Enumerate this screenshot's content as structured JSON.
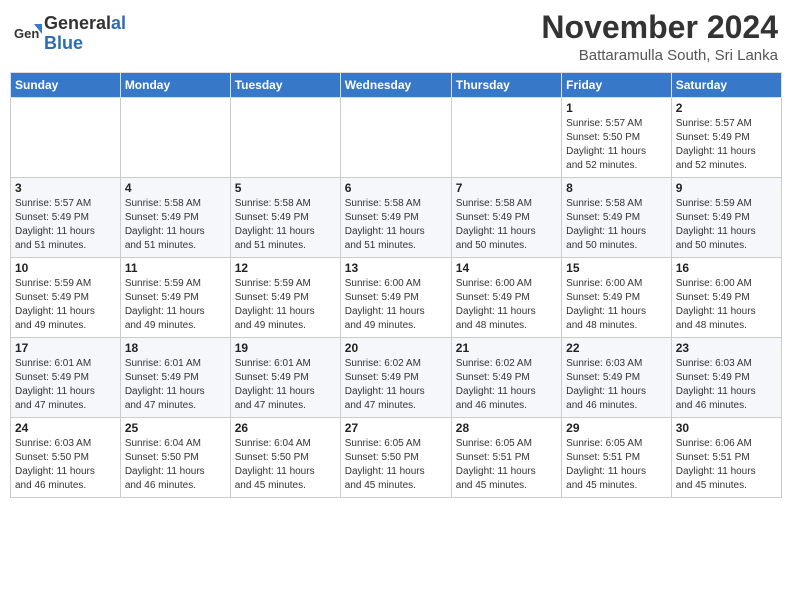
{
  "header": {
    "logo_line1": "General",
    "logo_line2": "Blue",
    "month": "November 2024",
    "location": "Battaramulla South, Sri Lanka"
  },
  "weekdays": [
    "Sunday",
    "Monday",
    "Tuesday",
    "Wednesday",
    "Thursday",
    "Friday",
    "Saturday"
  ],
  "weeks": [
    [
      {
        "day": "",
        "info": ""
      },
      {
        "day": "",
        "info": ""
      },
      {
        "day": "",
        "info": ""
      },
      {
        "day": "",
        "info": ""
      },
      {
        "day": "",
        "info": ""
      },
      {
        "day": "1",
        "info": "Sunrise: 5:57 AM\nSunset: 5:50 PM\nDaylight: 11 hours\nand 52 minutes."
      },
      {
        "day": "2",
        "info": "Sunrise: 5:57 AM\nSunset: 5:49 PM\nDaylight: 11 hours\nand 52 minutes."
      }
    ],
    [
      {
        "day": "3",
        "info": "Sunrise: 5:57 AM\nSunset: 5:49 PM\nDaylight: 11 hours\nand 51 minutes."
      },
      {
        "day": "4",
        "info": "Sunrise: 5:58 AM\nSunset: 5:49 PM\nDaylight: 11 hours\nand 51 minutes."
      },
      {
        "day": "5",
        "info": "Sunrise: 5:58 AM\nSunset: 5:49 PM\nDaylight: 11 hours\nand 51 minutes."
      },
      {
        "day": "6",
        "info": "Sunrise: 5:58 AM\nSunset: 5:49 PM\nDaylight: 11 hours\nand 51 minutes."
      },
      {
        "day": "7",
        "info": "Sunrise: 5:58 AM\nSunset: 5:49 PM\nDaylight: 11 hours\nand 50 minutes."
      },
      {
        "day": "8",
        "info": "Sunrise: 5:58 AM\nSunset: 5:49 PM\nDaylight: 11 hours\nand 50 minutes."
      },
      {
        "day": "9",
        "info": "Sunrise: 5:59 AM\nSunset: 5:49 PM\nDaylight: 11 hours\nand 50 minutes."
      }
    ],
    [
      {
        "day": "10",
        "info": "Sunrise: 5:59 AM\nSunset: 5:49 PM\nDaylight: 11 hours\nand 49 minutes."
      },
      {
        "day": "11",
        "info": "Sunrise: 5:59 AM\nSunset: 5:49 PM\nDaylight: 11 hours\nand 49 minutes."
      },
      {
        "day": "12",
        "info": "Sunrise: 5:59 AM\nSunset: 5:49 PM\nDaylight: 11 hours\nand 49 minutes."
      },
      {
        "day": "13",
        "info": "Sunrise: 6:00 AM\nSunset: 5:49 PM\nDaylight: 11 hours\nand 49 minutes."
      },
      {
        "day": "14",
        "info": "Sunrise: 6:00 AM\nSunset: 5:49 PM\nDaylight: 11 hours\nand 48 minutes."
      },
      {
        "day": "15",
        "info": "Sunrise: 6:00 AM\nSunset: 5:49 PM\nDaylight: 11 hours\nand 48 minutes."
      },
      {
        "day": "16",
        "info": "Sunrise: 6:00 AM\nSunset: 5:49 PM\nDaylight: 11 hours\nand 48 minutes."
      }
    ],
    [
      {
        "day": "17",
        "info": "Sunrise: 6:01 AM\nSunset: 5:49 PM\nDaylight: 11 hours\nand 47 minutes."
      },
      {
        "day": "18",
        "info": "Sunrise: 6:01 AM\nSunset: 5:49 PM\nDaylight: 11 hours\nand 47 minutes."
      },
      {
        "day": "19",
        "info": "Sunrise: 6:01 AM\nSunset: 5:49 PM\nDaylight: 11 hours\nand 47 minutes."
      },
      {
        "day": "20",
        "info": "Sunrise: 6:02 AM\nSunset: 5:49 PM\nDaylight: 11 hours\nand 47 minutes."
      },
      {
        "day": "21",
        "info": "Sunrise: 6:02 AM\nSunset: 5:49 PM\nDaylight: 11 hours\nand 46 minutes."
      },
      {
        "day": "22",
        "info": "Sunrise: 6:03 AM\nSunset: 5:49 PM\nDaylight: 11 hours\nand 46 minutes."
      },
      {
        "day": "23",
        "info": "Sunrise: 6:03 AM\nSunset: 5:49 PM\nDaylight: 11 hours\nand 46 minutes."
      }
    ],
    [
      {
        "day": "24",
        "info": "Sunrise: 6:03 AM\nSunset: 5:50 PM\nDaylight: 11 hours\nand 46 minutes."
      },
      {
        "day": "25",
        "info": "Sunrise: 6:04 AM\nSunset: 5:50 PM\nDaylight: 11 hours\nand 46 minutes."
      },
      {
        "day": "26",
        "info": "Sunrise: 6:04 AM\nSunset: 5:50 PM\nDaylight: 11 hours\nand 45 minutes."
      },
      {
        "day": "27",
        "info": "Sunrise: 6:05 AM\nSunset: 5:50 PM\nDaylight: 11 hours\nand 45 minutes."
      },
      {
        "day": "28",
        "info": "Sunrise: 6:05 AM\nSunset: 5:51 PM\nDaylight: 11 hours\nand 45 minutes."
      },
      {
        "day": "29",
        "info": "Sunrise: 6:05 AM\nSunset: 5:51 PM\nDaylight: 11 hours\nand 45 minutes."
      },
      {
        "day": "30",
        "info": "Sunrise: 6:06 AM\nSunset: 5:51 PM\nDaylight: 11 hours\nand 45 minutes."
      }
    ]
  ]
}
